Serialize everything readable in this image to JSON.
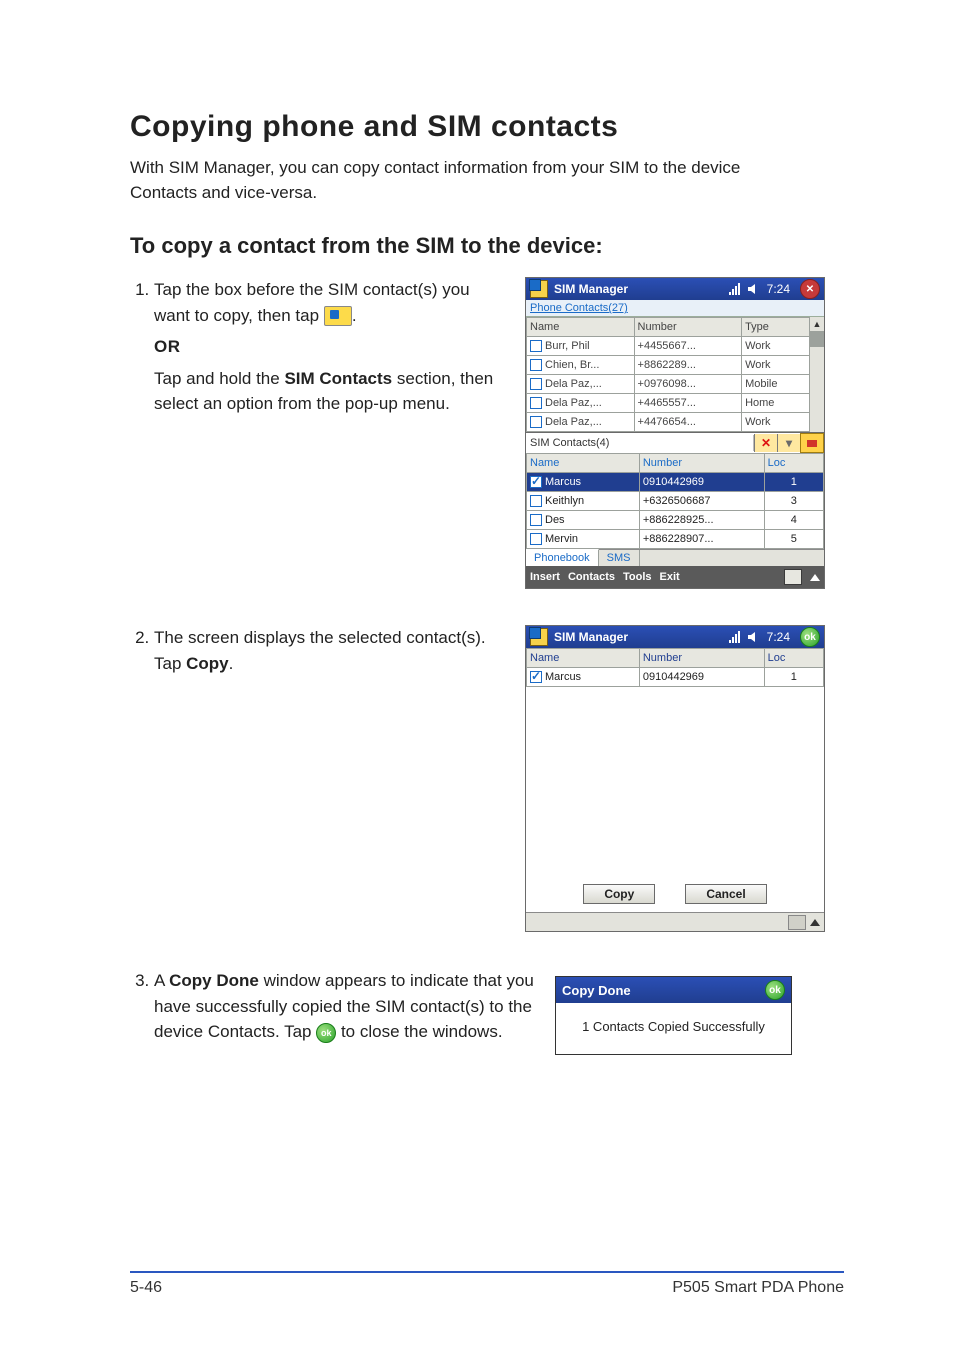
{
  "heading": "Copying phone and SIM contacts",
  "intro": "With SIM Manager, you can copy contact information from your SIM to the device Contacts and vice-versa.",
  "subhead": "To copy a contact from the SIM to the device:",
  "step1": {
    "text_a": "Tap the box before the SIM contact(s) you want to copy, then tap",
    "or": "OR",
    "text_b1": "Tap and hold the ",
    "text_b_bold": "SIM Contacts",
    "text_b2": " section, then select an option from the pop-up menu."
  },
  "step2": {
    "text_a": "The screen displays the selected contact(s). Tap ",
    "text_bold": "Copy",
    "text_b": "."
  },
  "step3": {
    "text_a": "A ",
    "text_bold": "Copy Done",
    "text_b": " window appears to indicate that you have successfully copied the SIM contact(s) to the device Contacts. Tap ",
    "text_c": " to close the windows."
  },
  "mini1": {
    "title": "SIM Manager",
    "time": "7:24",
    "phone_contacts_label": "Phone Contacts(27)",
    "columns_phone": {
      "c1": "Name",
      "c2": "Number",
      "c3": "Type"
    },
    "phone_rows": [
      {
        "name": "Burr, Phil",
        "number": "+4455667...",
        "type": "Work"
      },
      {
        "name": "Chien, Br...",
        "number": "+8862289...",
        "type": "Work"
      },
      {
        "name": "Dela Paz,...",
        "number": "+0976098...",
        "type": "Mobile"
      },
      {
        "name": "Dela Paz,...",
        "number": "+4465557...",
        "type": "Home"
      },
      {
        "name": "Dela Paz,...",
        "number": "+4476654...",
        "type": "Work"
      }
    ],
    "sim_contacts_label": "SIM Contacts(4)",
    "columns_sim": {
      "c1": "Name",
      "c2": "Number",
      "c3": "Loc"
    },
    "sim_rows": [
      {
        "name": "Marcus",
        "number": "0910442969",
        "loc": "1",
        "checked": true,
        "selected": true
      },
      {
        "name": "Keithlyn",
        "number": "+6326506687",
        "loc": "3"
      },
      {
        "name": "Des",
        "number": "+886228925...",
        "loc": "4"
      },
      {
        "name": "Mervin",
        "number": "+886228907...",
        "loc": "5"
      }
    ],
    "tabs": {
      "t1": "Phonebook",
      "t2": "SMS"
    },
    "menu": {
      "m1": "Insert",
      "m2": "Contacts",
      "m3": "Tools",
      "m4": "Exit"
    }
  },
  "mini2": {
    "title": "SIM Manager",
    "time": "7:24",
    "columns": {
      "c1": "Name",
      "c2": "Number",
      "c3": "Loc"
    },
    "row": {
      "name": "Marcus",
      "number": "0910442969",
      "loc": "1"
    },
    "btn_copy": "Copy",
    "btn_cancel": "Cancel"
  },
  "dlg": {
    "title": "Copy Done",
    "body": "1 Contacts Copied Successfully"
  },
  "footer": {
    "left": "5-46",
    "right": "P505 Smart PDA Phone"
  },
  "ok_label": "ok"
}
